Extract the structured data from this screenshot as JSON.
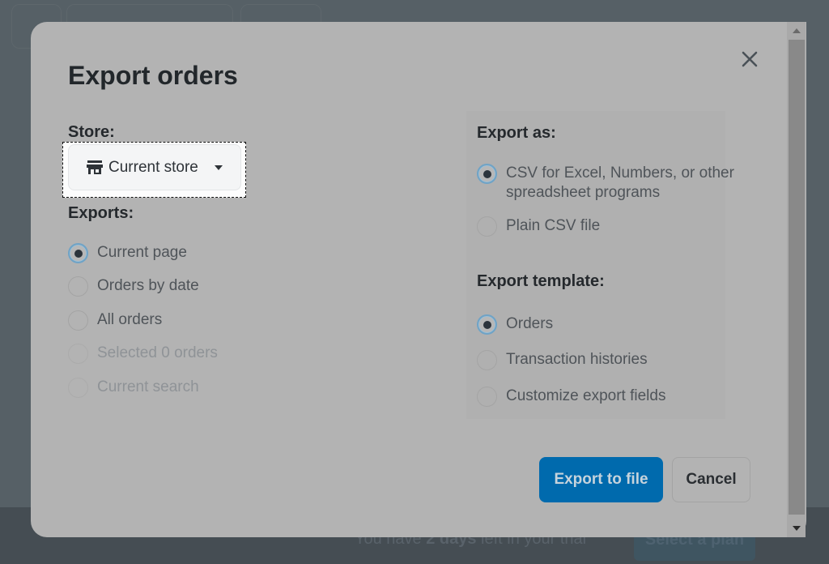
{
  "background": {
    "trial_prefix": "You have ",
    "trial_bold": "2 days",
    "trial_suffix": " left in your trial",
    "select_plan_label": "Select a plan"
  },
  "modal": {
    "title": "Export orders",
    "close_icon": "close-icon",
    "store": {
      "label": "Store:",
      "selected": "Current store",
      "icon": "store-icon",
      "caret_icon": "caret-down-icon"
    },
    "exports": {
      "label": "Exports:",
      "options": [
        {
          "label": "Current page",
          "checked": true,
          "disabled": false
        },
        {
          "label": "Orders by date",
          "checked": false,
          "disabled": false
        },
        {
          "label": "All orders",
          "checked": false,
          "disabled": false
        },
        {
          "label": "Selected 0 orders",
          "checked": false,
          "disabled": true
        },
        {
          "label": "Current search",
          "checked": false,
          "disabled": true
        }
      ]
    },
    "export_as": {
      "label": "Export as:",
      "options": [
        {
          "label_line1": "CSV for Excel, Numbers, or other",
          "label_line2": "spreadsheet programs",
          "checked": true
        },
        {
          "label_line1": "Plain CSV file",
          "label_line2": "",
          "checked": false
        }
      ]
    },
    "export_template": {
      "label": "Export template:",
      "options": [
        {
          "label": "Orders",
          "checked": true
        },
        {
          "label": "Transaction histories",
          "checked": false
        },
        {
          "label": "Customize export fields",
          "checked": false
        }
      ]
    },
    "buttons": {
      "export_label": "Export to file",
      "cancel_label": "Cancel"
    },
    "colors": {
      "primary": "#006aad",
      "radio_focus": "#6fa3c6"
    }
  }
}
